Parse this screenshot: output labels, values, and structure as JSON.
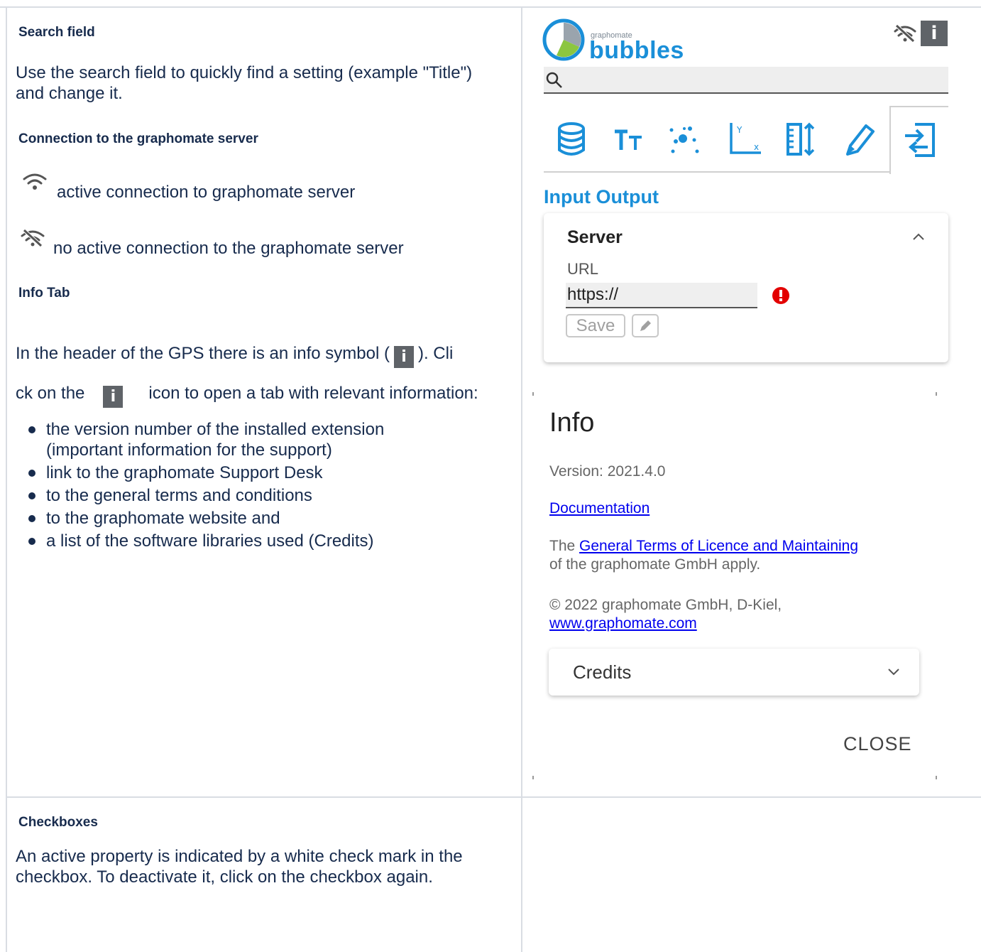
{
  "left_column": {
    "search_heading": "Search field",
    "search_text": "Use the search field to quickly find a setting (example \"Title\") and change it.",
    "connection_heading": "Connection to the graphomate server",
    "active_connection": "active connection to graphomate server",
    "no_connection": "no active connection to the graphomate server",
    "info_heading": "Info Tab",
    "info_text_1": "In the header of the GPS there is an info symbol (",
    "info_text_2": "). Cli",
    "info_text_3": "ck on the",
    "info_text_4": "icon to open a tab with relevant information:",
    "bullets": [
      "the version number of the installed extension (important information for the support)",
      "link to the graphomate Support Desk",
      "to the general terms and conditions",
      "to the graphomate website and",
      "a list of the software libraries used (Credits)"
    ],
    "checkboxes_heading": "Checkboxes",
    "checkboxes_text": "An active property is indicated by a white check mark in the checkbox. To deactivate it, click on the checkbox again."
  },
  "panel": {
    "logo_small": "graphomate",
    "logo_big": "bubbles",
    "info_glyph": "i",
    "section_title": "Input Output",
    "server_title": "Server",
    "url_label": "URL",
    "url_value": "https://",
    "save_label": "Save",
    "tabs": [
      "data-icon",
      "text-icon",
      "bubbles-icon",
      "axes-icon",
      "layout-icon",
      "pencil-icon",
      "input-output-icon"
    ],
    "accent_color": "#1a8fd8"
  },
  "info_dialog": {
    "title": "Info",
    "version": "Version: 2021.4.0",
    "documentation_link": "Documentation",
    "terms_prefix": "The",
    "terms_link": "General Terms of Licence and Maintaining",
    "terms_suffix": "of the graphomate GmbH apply.",
    "copyright": "© 2022 graphomate GmbH, D-Kiel,",
    "website_link": "www.graphomate.com",
    "credits_label": "Credits",
    "close_label": "CLOSE"
  }
}
